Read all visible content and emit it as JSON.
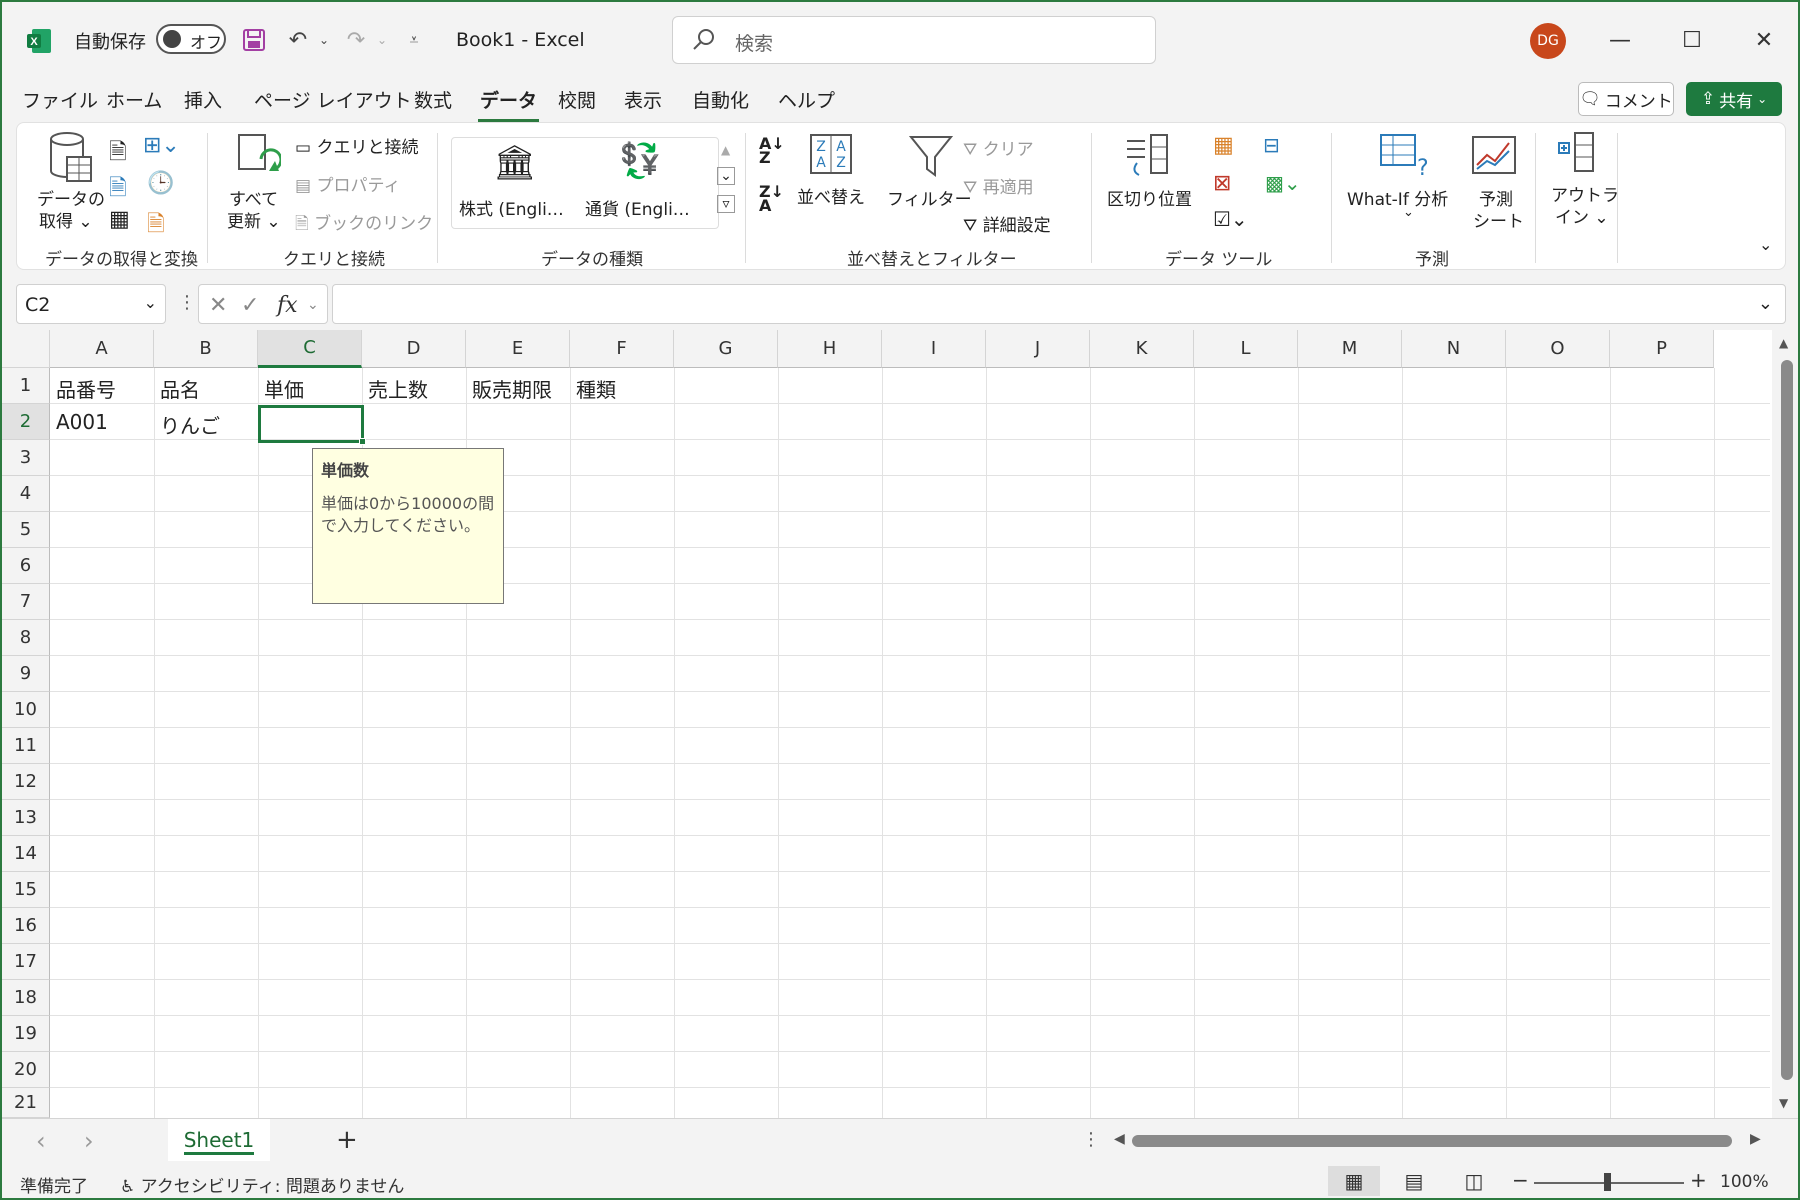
{
  "app": {
    "autosave_label": "自動保存",
    "autosave_state": "オフ",
    "doc_title": "Book1  -  Excel",
    "search_placeholder": "検索",
    "user_initials": "DG"
  },
  "menu_tabs": [
    "ファイル",
    "ホーム",
    "挿入",
    "ページ レイアウト",
    "数式",
    "データ",
    "校閲",
    "表示",
    "自動化",
    "ヘルプ"
  ],
  "active_tab": "データ",
  "top_buttons": {
    "comment": "コメント",
    "share": "共有"
  },
  "ribbon": {
    "get_data_1": "データの",
    "get_data_2": "取得 ⌄",
    "refresh_1": "すべて",
    "refresh_2": "更新 ⌄",
    "queries": "クエリと接続",
    "properties": "プロパティ",
    "book_links": "ブックのリンク",
    "stocks": "株式 (Engli…",
    "currency": "通貨 (Engli…",
    "sort": "並べ替え",
    "filter": "フィルター",
    "clear": "クリア",
    "reapply": "再適用",
    "advanced": "詳細設定",
    "text_to_columns": "区切り位置",
    "whatif_1": "What-If 分析",
    "whatif_2": "⌄",
    "forecast_1": "予測",
    "forecast_2": "シート",
    "outline_1": "アウトラ",
    "outline_2": "イン ⌄",
    "groups": {
      "get_transform": "データの取得と変換",
      "queries": "クエリと接続",
      "data_types": "データの種類",
      "sort_filter": "並べ替えとフィルター",
      "data_tools": "データ ツール",
      "forecast": "予測"
    }
  },
  "formula_bar": {
    "name_box": "C2",
    "fx": "fx",
    "value": ""
  },
  "columns": [
    "A",
    "B",
    "C",
    "D",
    "E",
    "F",
    "G",
    "H",
    "I",
    "J",
    "K",
    "L",
    "M",
    "N",
    "O",
    "P"
  ],
  "selected_column": "C",
  "rows": [
    "1",
    "2",
    "3",
    "4",
    "5",
    "6",
    "7",
    "8",
    "9",
    "10",
    "11",
    "12",
    "13",
    "14",
    "15",
    "16",
    "17",
    "18",
    "19",
    "20",
    "21"
  ],
  "selected_row": "2",
  "cells": {
    "A1": "品番号",
    "B1": "品名",
    "C1": "単価",
    "D1": "売上数",
    "E1": "販売期限",
    "F1": "種類",
    "A2": "A001",
    "B2": "りんご"
  },
  "tooltip": {
    "title": "単価数",
    "body_1": "単価は0から10000の間",
    "body_2": "で入力してください。"
  },
  "sheet_tabs": [
    "Sheet1"
  ],
  "status": {
    "ready": "準備完了",
    "accessibility": "アクセシビリティ: 問題ありません",
    "zoom": "100%"
  },
  "colors": {
    "accent": "#1e7a3f",
    "tooltip_bg": "#ffffe1",
    "avatar": "#c8471b"
  }
}
